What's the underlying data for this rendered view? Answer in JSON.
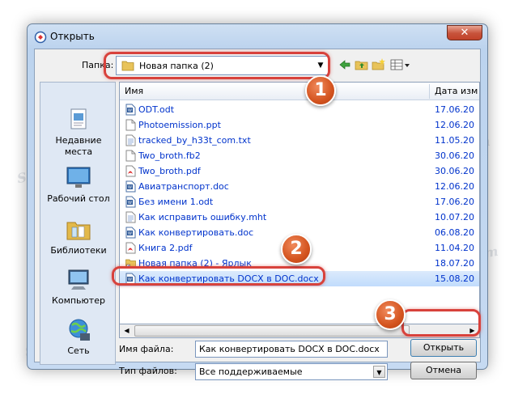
{
  "window": {
    "title": "Открыть",
    "close_label": "✕"
  },
  "toolbar": {
    "lookin_label": "Папка:",
    "lookin_value": "Новая папка (2)"
  },
  "places": [
    {
      "label": "Недавние места",
      "icon": "recent-places-icon"
    },
    {
      "label": "Рабочий стол",
      "icon": "desktop-icon"
    },
    {
      "label": "Библиотеки",
      "icon": "libraries-icon"
    },
    {
      "label": "Компьютер",
      "icon": "computer-icon"
    },
    {
      "label": "Сеть",
      "icon": "network-icon"
    }
  ],
  "filelist": {
    "columns": {
      "name": "Имя",
      "date": "Дата изм"
    },
    "rows": [
      {
        "name": "ODT.odt",
        "date": "17.06.20",
        "icon": "word-doc-icon"
      },
      {
        "name": "Photoemission.ppt",
        "date": "12.06.20",
        "icon": "generic-file-icon"
      },
      {
        "name": "tracked_by_h33t_com.txt",
        "date": "11.05.20",
        "icon": "text-file-icon"
      },
      {
        "name": "Two_broth.fb2",
        "date": "30.06.20",
        "icon": "generic-file-icon"
      },
      {
        "name": "Two_broth.pdf",
        "date": "30.06.20",
        "icon": "pdf-file-icon"
      },
      {
        "name": "Авиатранспорт.doc",
        "date": "12.06.20",
        "icon": "word-doc-icon"
      },
      {
        "name": "Без имени 1.odt",
        "date": "17.06.20",
        "icon": "word-doc-icon"
      },
      {
        "name": "Как исправить ошибку.mht",
        "date": "10.07.20",
        "icon": "text-file-icon"
      },
      {
        "name": "Как конвертировать.doc",
        "date": "06.08.20",
        "icon": "word-doc-icon"
      },
      {
        "name": "Книга 2.pdf",
        "date": "11.04.20",
        "icon": "pdf-file-icon"
      },
      {
        "name": "Новая папка (2) - Ярлык",
        "date": "18.07.20",
        "icon": "folder-shortcut-icon"
      },
      {
        "name": "Как конвертировать DOCX в DOC.docx",
        "date": "15.08.20",
        "icon": "word-doc-icon",
        "selected": true
      }
    ]
  },
  "filename": {
    "label": "Имя файла:",
    "value": "Как конвертировать DOCX в DOC.docx"
  },
  "filetype": {
    "label": "Тип файлов:",
    "value": "Все поддерживаемые"
  },
  "buttons": {
    "open": "Открыть",
    "cancel": "Отмена"
  },
  "badges": [
    "1",
    "2",
    "3"
  ],
  "watermark": "Soringpcrepair.com",
  "colors": {
    "highlight": "#d8423c",
    "badge": "#d4541f",
    "link": "#0033cc"
  }
}
